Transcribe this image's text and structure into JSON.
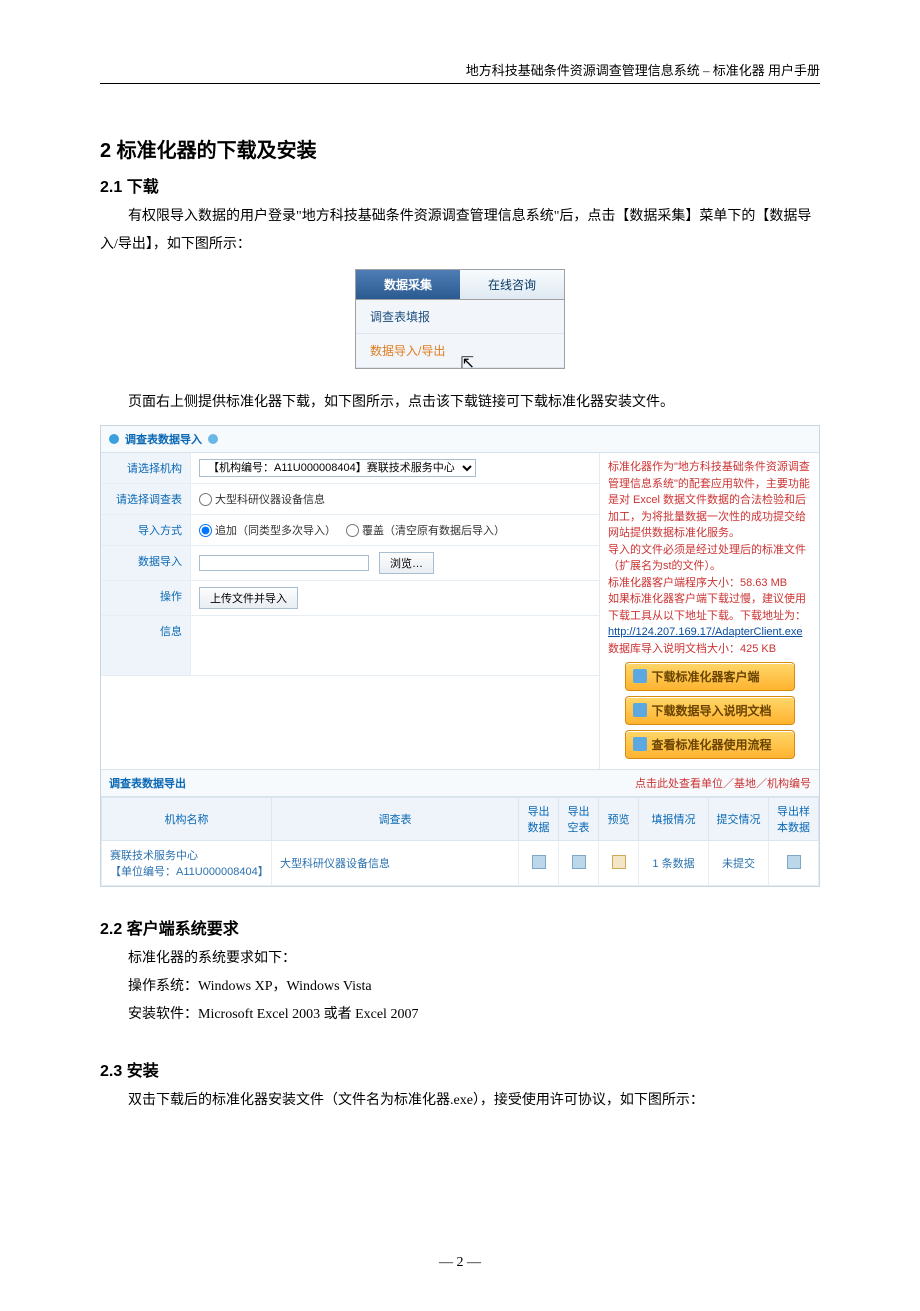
{
  "header": "地方科技基础条件资源调查管理信息系统 – 标准化器 用户手册",
  "sec2_title": "2  标准化器的下载及安装",
  "sec21_title": "2.1 下载",
  "p21a": "有权限导入数据的用户登录\"地方科技基础条件资源调查管理信息系统\"后，点击【数据采集】菜单下的【数据导入/导出】，如下图所示：",
  "menu": {
    "tab_active": "数据采集",
    "tab_other": "在线咨询",
    "item1": "调查表填报",
    "item2": "数据导入/导出"
  },
  "p21b": "页面右上侧提供标准化器下载，如下图所示，点击该下载链接可下载标准化器安装文件。",
  "import_panel": {
    "title": "调查表数据导入",
    "row_org_label": "请选择机构",
    "row_org_value": "【机构编号：A11U000008404】赛联技术服务中心",
    "row_table_label": "请选择调查表",
    "row_table_opt": "大型科研仪器设备信息",
    "row_mode_label": "导入方式",
    "row_mode_opt1": "追加（同类型多次导入）",
    "row_mode_opt2": "覆盖（清空原有数据后导入）",
    "row_data_label": "数据导入",
    "row_data_btn": "浏览…",
    "row_op_label": "操作",
    "row_op_btn": "上传文件并导入",
    "row_info_label": "信息"
  },
  "side": {
    "l1": "标准化器作为\"地方科技基础条件资源调查管理信息系统\"的配套应用软件，主要功能是对 Excel 数据文件数据的合法检验和后加工，为将批量数据一次性的成功提交给网站提供数据标准化服务。",
    "l2": "导入的文件必须是经过处理后的标准文件（扩展名为st的文件）。",
    "l3": "标准化器客户端程序大小：58.63 MB",
    "l4": "如果标准化器客户端下载过慢，建议使用下载工具从以下地址下载。下载地址为：",
    "url": "http://124.207.169.17/AdapterClient.exe",
    "l5": "数据库导入说明文档大小：425 KB",
    "btn1": "下载标准化器客户端",
    "btn2": "下载数据导入说明文档",
    "btn3": "查看标准化器使用流程"
  },
  "export_panel": {
    "title": "调查表数据导出",
    "right_link": "点击此处查看单位／基地／机构编号",
    "th_org": "机构名称",
    "th_table": "调查表",
    "th_data": "导出数据",
    "th_blank": "导出空表",
    "th_preview": "预览",
    "th_fill": "填报情况",
    "th_submit": "提交情况",
    "th_sample": "导出样本数据",
    "td_org": "赛联技术服务中心\n【单位编号：A11U000008404】",
    "td_table": "大型科研仪器设备信息",
    "td_fill": "1 条数据",
    "td_submit": "未提交"
  },
  "sec22_title": "2.2 客户端系统要求",
  "p22a": "标准化器的系统要求如下：",
  "p22b": "操作系统：Windows XP，Windows Vista",
  "p22c": "安装软件：Microsoft Excel 2003 或者 Excel 2007",
  "sec23_title": "2.3 安装",
  "p23a": "双击下载后的标准化器安装文件（文件名为标准化器.exe），接受使用许可协议，如下图所示：",
  "page_number": "— 2 —"
}
